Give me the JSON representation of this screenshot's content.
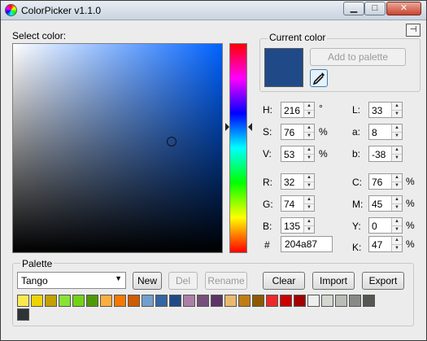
{
  "window": {
    "title": "ColorPicker v1.1.0",
    "minimize": "▁",
    "maximize": "□",
    "close": "✕",
    "pin": "⊣"
  },
  "select_color_label": "Select color:",
  "current_color": {
    "group_label": "Current color",
    "hex_color": "#204a87",
    "add_to_palette": "Add to palette",
    "eyedropper": "eyedropper-icon"
  },
  "sv_picker": {
    "saturation": 0.76,
    "value": 0.53
  },
  "hue_slider": {
    "hue_fraction": 0.4
  },
  "fields": {
    "H": {
      "label": "H:",
      "value": "216",
      "unit": "°"
    },
    "S": {
      "label": "S:",
      "value": "76",
      "unit": "%"
    },
    "V": {
      "label": "V:",
      "value": "53",
      "unit": "%"
    },
    "L": {
      "label": "L:",
      "value": "33"
    },
    "a": {
      "label": "a:",
      "value": "8"
    },
    "b": {
      "label": "b:",
      "value": "-38"
    },
    "R": {
      "label": "R:",
      "value": "32"
    },
    "G": {
      "label": "G:",
      "value": "74"
    },
    "B": {
      "label": "B:",
      "value": "135"
    },
    "C": {
      "label": "C:",
      "value": "76",
      "unit": "%"
    },
    "M": {
      "label": "M:",
      "value": "45",
      "unit": "%"
    },
    "Y": {
      "label": "Y:",
      "value": "0",
      "unit": "%"
    },
    "K": {
      "label": "K:",
      "value": "47",
      "unit": "%"
    },
    "hex": {
      "label": "#",
      "value": "204a87"
    }
  },
  "palette": {
    "group_label": "Palette",
    "selected": "Tango",
    "buttons": {
      "new": "New",
      "del": "Del",
      "rename": "Rename",
      "clear": "Clear",
      "import": "Import",
      "export": "Export"
    },
    "swatches": [
      "#fce94f",
      "#edd400",
      "#c4a000",
      "#8ae234",
      "#73d216",
      "#4e9a06",
      "#fcaf3e",
      "#f57900",
      "#ce5c00",
      "#729fcf",
      "#3465a4",
      "#204a87",
      "#ad7fa8",
      "#75507b",
      "#5c3566",
      "#e9b96e",
      "#c17d11",
      "#8f5902",
      "#ef2929",
      "#cc0000",
      "#a40000",
      "#eeeeec",
      "#d3d7cf",
      "#babdb6",
      "#888a85",
      "#555753",
      "#2e3436"
    ]
  }
}
